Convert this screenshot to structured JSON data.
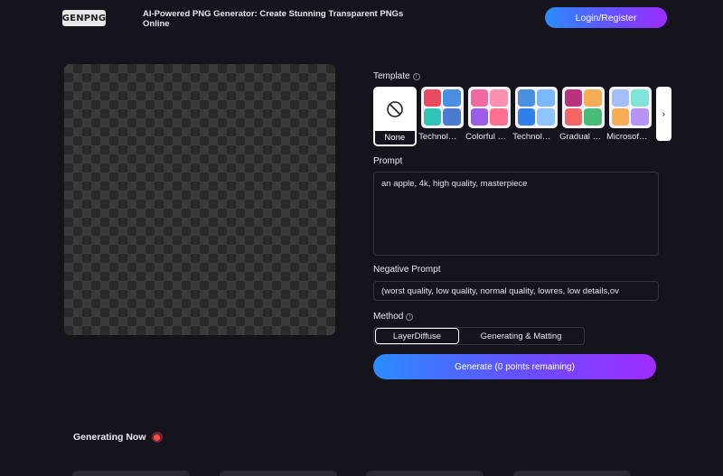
{
  "header": {
    "logo_text": "GENPNG",
    "tagline": "AI-Powered PNG Generator: Create Stunning Transparent PNGs Online",
    "login_label": "Login/Register"
  },
  "template": {
    "label": "Template",
    "info_icon": "info-icon",
    "none_label": "None",
    "items": [
      {
        "label": "Technol…",
        "colors": [
          "#e84a5f",
          "#4a90e2",
          "#2ec4b6",
          "#4a7bd0"
        ]
      },
      {
        "label": "Colorful …",
        "colors": [
          "#f06aa0",
          "#ff8fb0",
          "#9b5de5",
          "#ff6f91"
        ]
      },
      {
        "label": "Technol…",
        "colors": [
          "#4a90e2",
          "#7ab8ff",
          "#2f80ed",
          "#8ec5ff"
        ]
      },
      {
        "label": "Gradual …",
        "colors": [
          "#b83280",
          "#f6ad55",
          "#f56565",
          "#48bb78"
        ]
      },
      {
        "label": "Microsof…",
        "colors": [
          "#a3bffa",
          "#81e6d9",
          "#f6ad55",
          "#b794f4"
        ]
      }
    ],
    "next_icon": "chevron-right-icon"
  },
  "prompt": {
    "label": "Prompt",
    "value": "an apple, 4k, high quality, masterpiece"
  },
  "negative_prompt": {
    "label": "Negative Prompt",
    "value": "(worst quality, low quality, normal quality, lowres, low details,ov"
  },
  "method": {
    "label": "Method",
    "options": [
      "LayerDiffuse",
      "Generating & Matting"
    ],
    "selected": "LayerDiffuse"
  },
  "generate_label": "Generate (0 points remaining)",
  "generating_now_label": "Generating Now"
}
